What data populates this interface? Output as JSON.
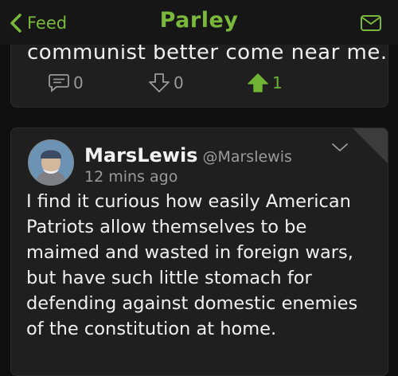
{
  "nav": {
    "back_label": "Feed",
    "title": "Parley",
    "back_icon": "chevron-left-icon",
    "mail_icon": "envelope-icon"
  },
  "accent_color": "#79b83a",
  "previous_post": {
    "clipped_text": "communist better come near me.",
    "comments": "0",
    "downvotes": "0",
    "upvotes": "1"
  },
  "post": {
    "author": "MarsLewis",
    "handle": "@Marslewis",
    "time": "12 mins ago",
    "body": "I find it curious how easily American Patriots allow themselves to be maimed and wasted in foreign wars, but have such little stomach for defending against domestic enemies of the constitution at home."
  }
}
